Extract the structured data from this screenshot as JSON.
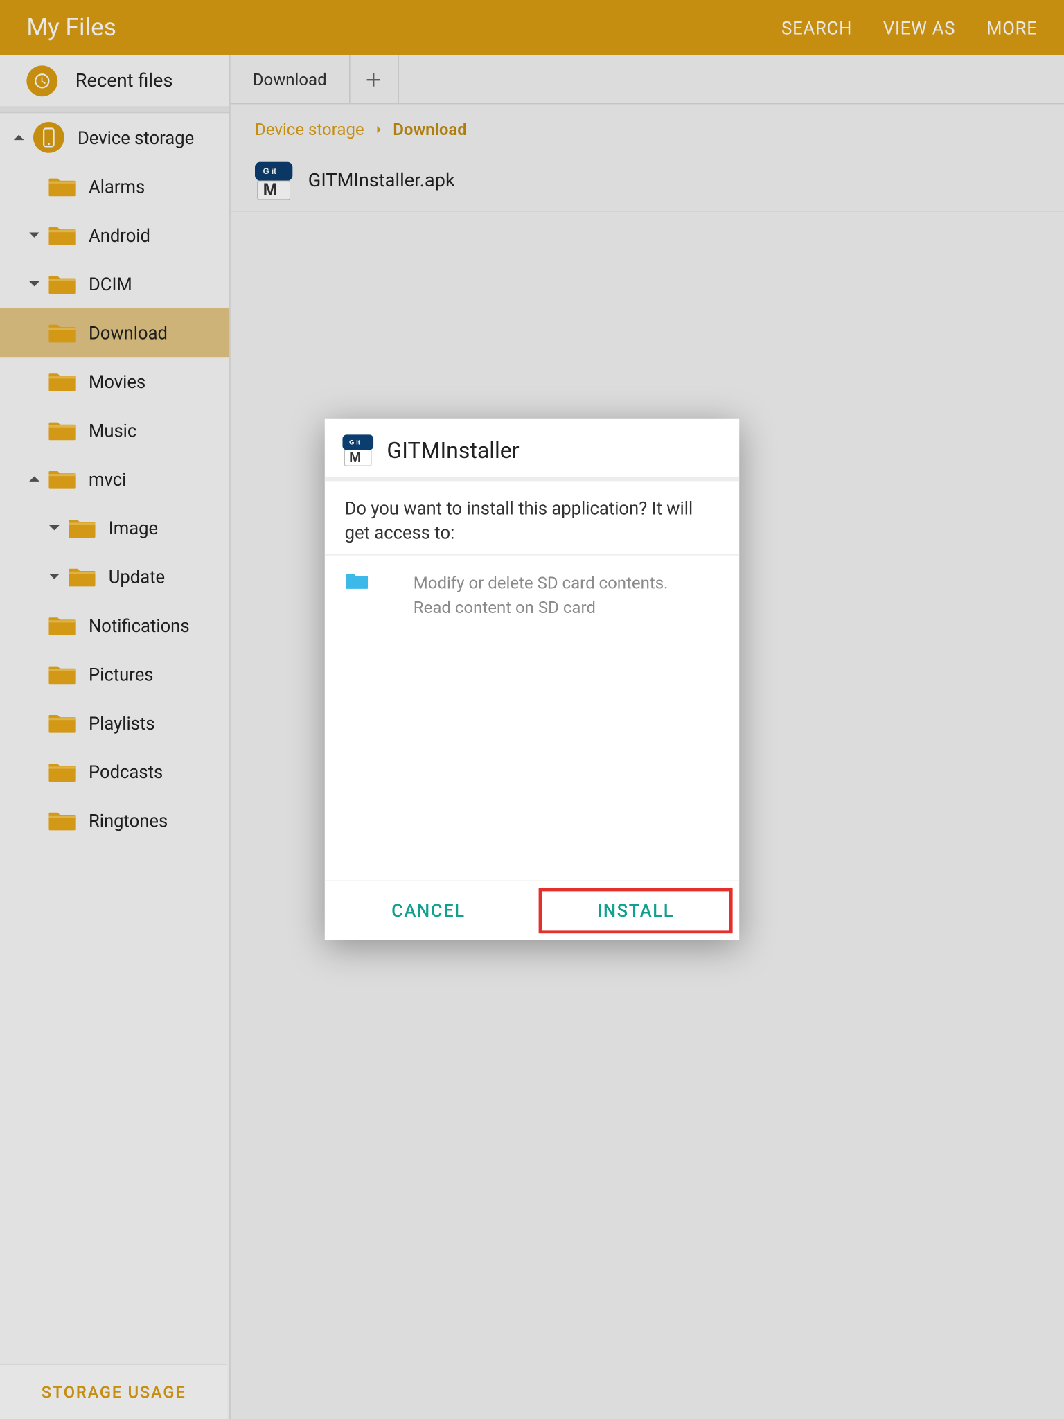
{
  "colors": {
    "accent": "#d99d13",
    "teal": "#0fa08f",
    "highlight": "#e3302b"
  },
  "topbar": {
    "title": "My Files",
    "actions": {
      "search": "SEARCH",
      "view_as": "VIEW AS",
      "more": "MORE"
    }
  },
  "sidebar": {
    "recent_label": "Recent files",
    "storage_usage": "STORAGE USAGE",
    "tree": [
      {
        "label": "Device storage",
        "depth": 0,
        "chevron": "up",
        "icon": "device"
      },
      {
        "label": "Alarms",
        "depth": 1,
        "chevron": "none",
        "icon": "folder"
      },
      {
        "label": "Android",
        "depth": 1,
        "chevron": "down",
        "icon": "folder"
      },
      {
        "label": "DCIM",
        "depth": 1,
        "chevron": "down",
        "icon": "folder"
      },
      {
        "label": "Download",
        "depth": 1,
        "chevron": "none",
        "icon": "folder",
        "selected": true
      },
      {
        "label": "Movies",
        "depth": 1,
        "chevron": "none",
        "icon": "folder"
      },
      {
        "label": "Music",
        "depth": 1,
        "chevron": "none",
        "icon": "folder"
      },
      {
        "label": "mvci",
        "depth": 1,
        "chevron": "up",
        "icon": "folder"
      },
      {
        "label": "Image",
        "depth": 2,
        "chevron": "down",
        "icon": "folder"
      },
      {
        "label": "Update",
        "depth": 2,
        "chevron": "down",
        "icon": "folder"
      },
      {
        "label": "Notifications",
        "depth": 1,
        "chevron": "none",
        "icon": "folder"
      },
      {
        "label": "Pictures",
        "depth": 1,
        "chevron": "none",
        "icon": "folder"
      },
      {
        "label": "Playlists",
        "depth": 1,
        "chevron": "none",
        "icon": "folder"
      },
      {
        "label": "Podcasts",
        "depth": 1,
        "chevron": "none",
        "icon": "folder"
      },
      {
        "label": "Ringtones",
        "depth": 1,
        "chevron": "none",
        "icon": "folder"
      }
    ]
  },
  "content": {
    "tab_label": "Download",
    "breadcrumb": {
      "root": "Device storage",
      "current": "Download"
    },
    "file": {
      "name": "GITMInstaller.apk"
    }
  },
  "dialog": {
    "app_name": "GITMInstaller",
    "prompt": "Do you want to install this application? It will get access to:",
    "permission_line1": "Modify or delete SD card contents.",
    "permission_line2": "Read content on SD card",
    "cancel": "CANCEL",
    "install": "INSTALL"
  }
}
